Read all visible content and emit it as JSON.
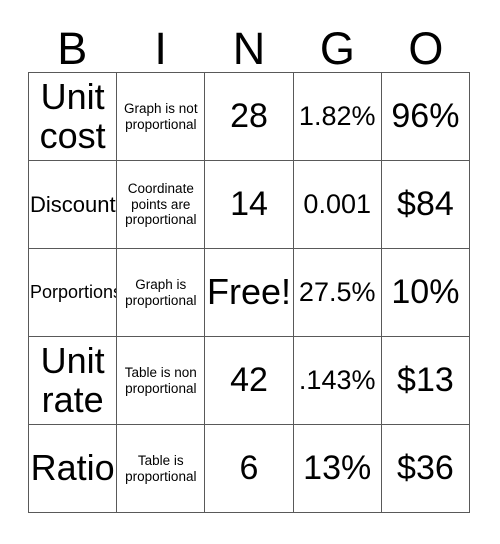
{
  "card": {
    "title_letters": [
      "B",
      "I",
      "N",
      "G",
      "O"
    ],
    "free_space_label": "Free!",
    "grid_line_color": "#595959",
    "text_color": "#000000",
    "background_color": "#ffffff",
    "rows": 5,
    "columns": 5
  },
  "cells": [
    [
      {
        "text": "Unit cost",
        "size": "sz-xl"
      },
      {
        "text": "Graph is not proportional",
        "size": "sz-xs"
      },
      {
        "text": "28",
        "size": "sz-lg"
      },
      {
        "text": "1.82%",
        "size": "sz-md"
      },
      {
        "text": "96%",
        "size": "sz-lg"
      }
    ],
    [
      {
        "text": "Discount",
        "size": "sz-sm"
      },
      {
        "text": "Coordinate points are proportional",
        "size": "sz-xs"
      },
      {
        "text": "14",
        "size": "sz-lg"
      },
      {
        "text": "0.001",
        "size": "sz-md"
      },
      {
        "text": "$84",
        "size": "sz-lg"
      }
    ],
    [
      {
        "text": "Porportions",
        "size": "sz-porportions"
      },
      {
        "text": "Graph is proportional",
        "size": "sz-xs"
      },
      {
        "text": "Free!",
        "size": "sz-xl"
      },
      {
        "text": "27.5%",
        "size": "sz-md"
      },
      {
        "text": "10%",
        "size": "sz-lg"
      }
    ],
    [
      {
        "text": "Unit rate",
        "size": "sz-xl"
      },
      {
        "text": "Table is non proportional",
        "size": "sz-xs"
      },
      {
        "text": "42",
        "size": "sz-lg"
      },
      {
        "text": ".143%",
        "size": "sz-md"
      },
      {
        "text": "$13",
        "size": "sz-lg"
      }
    ],
    [
      {
        "text": "Ratio",
        "size": "sz-xl"
      },
      {
        "text": "Table is proportional",
        "size": "sz-xs"
      },
      {
        "text": "6",
        "size": "sz-lg"
      },
      {
        "text": "13%",
        "size": "sz-lg"
      },
      {
        "text": "$36",
        "size": "sz-lg"
      }
    ]
  ]
}
